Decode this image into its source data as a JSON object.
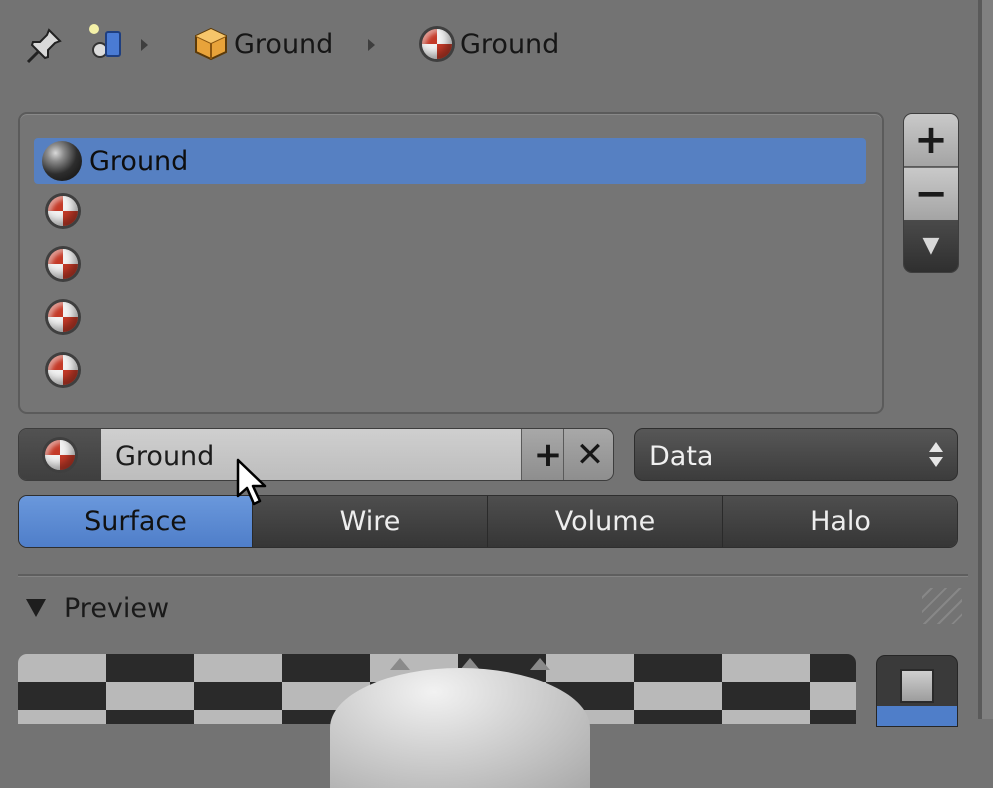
{
  "breadcrumb": {
    "items": [
      {
        "label": "Ground",
        "icon": "object-cube-icon"
      },
      {
        "label": "Ground",
        "icon": "material-icon"
      }
    ]
  },
  "material_slots": [
    {
      "label": "Ground",
      "selected": true,
      "icon": "material-sphere-icon"
    },
    {
      "label": "",
      "selected": false,
      "icon": "material-icon"
    },
    {
      "label": "",
      "selected": false,
      "icon": "material-icon"
    },
    {
      "label": "",
      "selected": false,
      "icon": "material-icon"
    },
    {
      "label": "",
      "selected": false,
      "icon": "material-icon"
    }
  ],
  "slot_buttons": {
    "add": "+",
    "remove": "−",
    "menu": "▼"
  },
  "material_id": {
    "name": "Ground",
    "add_glyph": "+",
    "unlink_glyph": "✕"
  },
  "link_dropdown": {
    "value": "Data"
  },
  "tabs": [
    "Surface",
    "Wire",
    "Volume",
    "Halo"
  ],
  "active_tab": "Surface",
  "preview": {
    "title": "Preview"
  },
  "colors": {
    "selection": "#5680c2",
    "active_tab": "#5a8ad4",
    "panel_bg": "#737373"
  }
}
